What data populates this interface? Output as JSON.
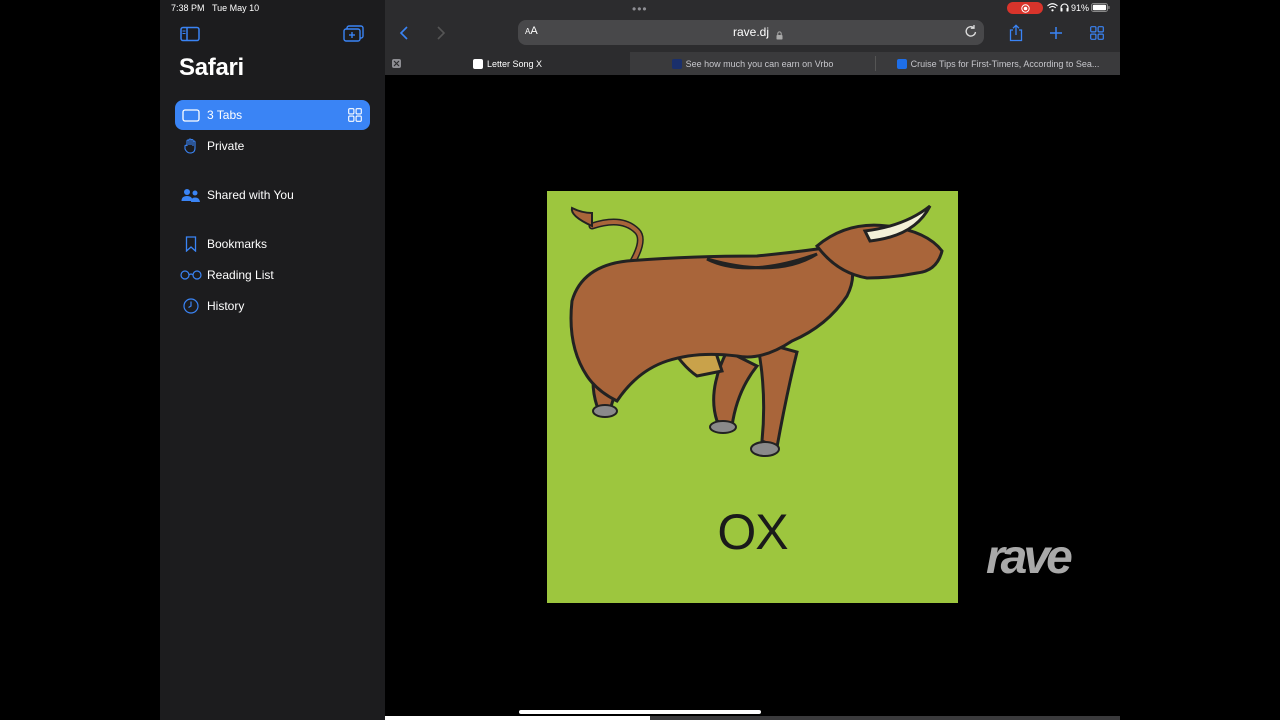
{
  "status": {
    "time": "7:38 PM",
    "date": "Tue May 10",
    "battery": "91%"
  },
  "sidebar": {
    "title": "Safari",
    "items": [
      {
        "label": "3 Tabs",
        "icon": "tablet-icon",
        "active": true
      },
      {
        "label": "Private",
        "icon": "hand-icon"
      },
      {
        "label": "Shared with You",
        "icon": "people-icon"
      },
      {
        "label": "Bookmarks",
        "icon": "bookmark-icon"
      },
      {
        "label": "Reading List",
        "icon": "glasses-icon"
      },
      {
        "label": "History",
        "icon": "clock-icon"
      }
    ]
  },
  "toolbar": {
    "aa_small": "A",
    "aa_large": "A",
    "url": "rave.dj"
  },
  "tabs": [
    {
      "label": "Letter Song X",
      "active": true,
      "favicon_color": "#ffffff"
    },
    {
      "label": "See how much you can earn on Vrbo",
      "active": false,
      "favicon_color": "#1a2f6b"
    },
    {
      "label": "Cruise Tips for First-Timers, According to Sea...",
      "active": false,
      "favicon_color": "#1e6ee8"
    }
  ],
  "video": {
    "caption": "OX",
    "watermark": "rave",
    "progress": 0.36
  },
  "colors": {
    "accent": "#3a84f5",
    "video_background": "#9dc63e",
    "sidebar": "#1c1c1e",
    "toolbar": "#2c2c2e"
  }
}
